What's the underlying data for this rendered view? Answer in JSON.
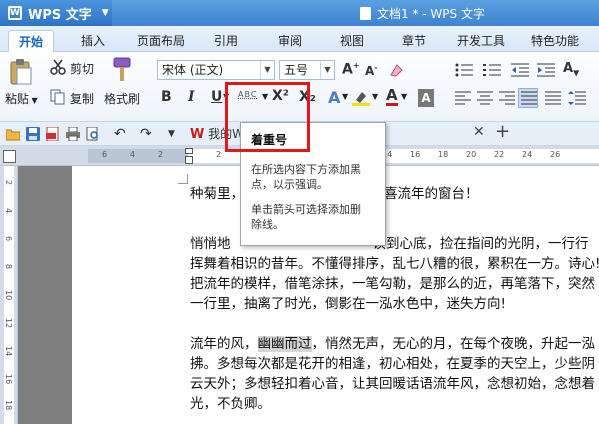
{
  "app": {
    "name": "WPS 文字",
    "document_title": "文档1 * - WPS 文字"
  },
  "menu": {
    "tabs": [
      "开始",
      "插入",
      "页面布局",
      "引用",
      "审阅",
      "视图",
      "章节",
      "开发工具",
      "特色功能"
    ],
    "active": "开始"
  },
  "ribbon": {
    "cut_label": "剪切",
    "copy_label": "复制",
    "format_painter_label": "格式刷",
    "paste_label": "粘贴",
    "font_name": "宋体 (正文)",
    "font_size": "五号",
    "emphasis_label": "ABC",
    "bold": "B",
    "italic": "I",
    "underline": "U",
    "superscript": "X²",
    "subscript": "X₂",
    "font_color": "A"
  },
  "quick_access": {
    "doc_tab_label": "我的W"
  },
  "tooltip": {
    "title": "着重号",
    "desc1_line1": "在所选内容下方添加黑",
    "desc1_line2": "点，以示强调。",
    "desc2_line1": "单击箭头可选择添加删",
    "desc2_line2": "除线。"
  },
  "ruler": {
    "h_numbers": [
      "6",
      "4",
      "2",
      "2",
      "4",
      "6",
      "8",
      "10",
      "12",
      "14",
      "16",
      "18",
      "20",
      "22",
      "24",
      "26"
    ],
    "v_numbers": [
      "2",
      "4",
      "6",
      "8",
      "10",
      "12",
      "14",
      "16",
      "18",
      "20"
    ]
  },
  "document": {
    "para1": "种菊里，",
    "para1_right": "喜流年的窗台！",
    "para2_l1_a": "悄悄地",
    "para2_l1_b": "读到心底，捡在指间的光阴，一行行",
    "para2_l2": "挥舞着相识的昔年。不懂得排序，乱七八糟的很，累积在一方。诗心!",
    "para2_l3": "把流年的模样，借笔涂抹，一笔勾勒，是那么的近，再笔落下，突然",
    "para2_l4": "一行里，抽离了时光，倒影在一泓水色中，迷失方向!",
    "para3_l1_a": "流年的风，",
    "para3_l1_sel": "幽幽而过",
    "para3_l1_b": "，悄然无声，无心的月，在每个夜晚，升起一泓",
    "para3_l2": "拂。多想每次都是花开的相逢，初心相处，在夏季的天空上，少些阴",
    "para3_l3": "云天外；多想轻扣着心音，让其回暖话语流年风，念想初始，念想着",
    "para3_l4": "光，不负卿。"
  },
  "colors": {
    "titlebar": "#3d83cf",
    "highlight_border": "#e01818",
    "active_tab_text": "#1c64b8"
  }
}
